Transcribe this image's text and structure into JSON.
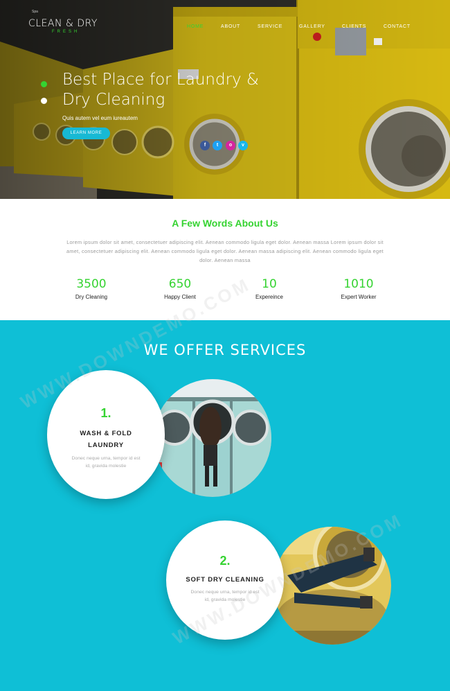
{
  "logo": {
    "tag": "Spa",
    "main": "CLEAN & DRY",
    "sub": "FRESH"
  },
  "nav": {
    "items": [
      {
        "label": "HOME",
        "active": true
      },
      {
        "label": "ABOUT",
        "active": false
      },
      {
        "label": "SERVICE",
        "active": false
      },
      {
        "label": "GALLERY",
        "active": false
      },
      {
        "label": "CLIENTS",
        "active": false
      },
      {
        "label": "CONTACT",
        "active": false
      }
    ]
  },
  "hero": {
    "title_line1": "Best Place for Laundry &",
    "title_line2": "Dry Cleaning",
    "subtitle": "Quis autem vel eum iureautem",
    "button_label": "LEARN MORE",
    "socials": [
      {
        "icon": "facebook-icon",
        "glyph": "f",
        "color": "#3b5998"
      },
      {
        "icon": "twitter-icon",
        "glyph": "t",
        "color": "#1da1f2"
      },
      {
        "icon": "instagram-icon",
        "glyph": "o",
        "color": "#d6249f"
      },
      {
        "icon": "vimeo-icon",
        "glyph": "v",
        "color": "#1ab7ea"
      }
    ]
  },
  "about": {
    "title": "A Few Words About Us",
    "paragraph": "Lorem ipsum dolor sit amet, consectetuer adipiscing elit. Aenean commodo ligula eget dolor. Aenean massa Lorem ipsum dolor sit amet, consectetuer adipiscing elit. Aenean commodo ligula eget dolor. Aenean massa adipiscing elit. Aenean commodo ligula eget dolor. Aenean massa",
    "stats": [
      {
        "number": "3500",
        "label": "Dry Cleaning"
      },
      {
        "number": "650",
        "label": "Happy Client"
      },
      {
        "number": "10",
        "label": "Expereince"
      },
      {
        "number": "1010",
        "label": "Expert Worker"
      }
    ]
  },
  "services": {
    "title": "WE OFFER SERVICES",
    "items": [
      {
        "number": "1.",
        "title_line1": "WASH & FOLD",
        "title_line2": "LAUNDRY",
        "text_line1": "Donec neque urna, tempor id est",
        "text_line2": "id, gravida molestie"
      },
      {
        "number": "2.",
        "title_line1": "SOFT DRY CLEANING",
        "title_line2": "",
        "text_line1": "Donec neque urna, tempor id est",
        "text_line2": "id, gravida molestie"
      }
    ]
  },
  "watermark": "WWW.DOWNDEMO.COM",
  "colors": {
    "accent_green": "#35d331",
    "brand_cyan": "#0fbfd6",
    "button_cyan": "#17b9d4",
    "machine_yellow": "#e2c313"
  }
}
